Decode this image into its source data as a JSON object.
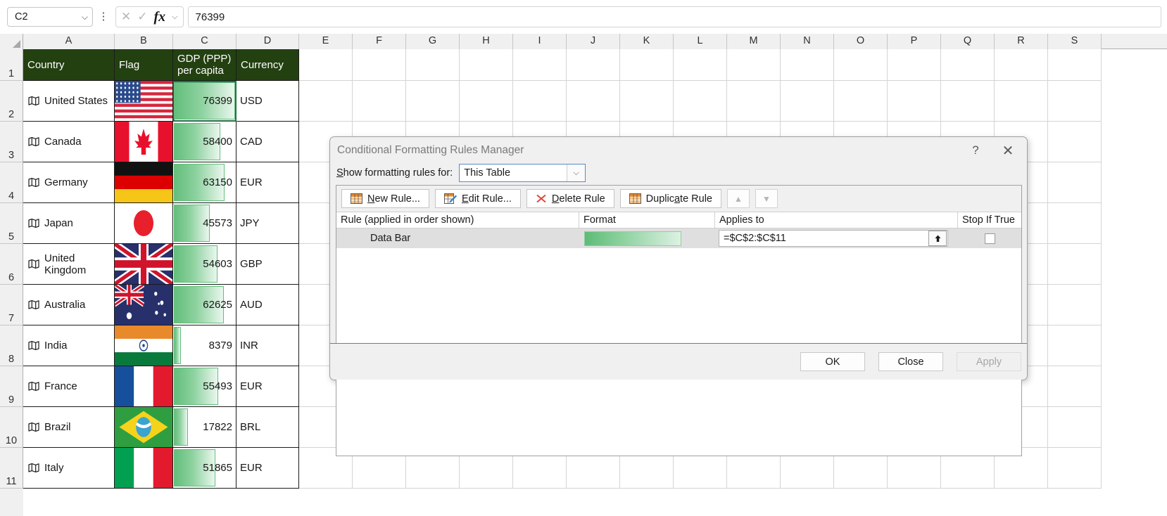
{
  "formula_bar": {
    "name_box": "C2",
    "name_box_chevron": "chevron-down-icon",
    "menu_icon": "⋮",
    "cancel_icon": "✕",
    "confirm_icon": "✓",
    "fx_icon": "fx",
    "fx_chevron": "chevron-down-icon",
    "formula_value": "76399"
  },
  "grid": {
    "columns": [
      "A",
      "B",
      "C",
      "D",
      "E",
      "F",
      "G",
      "H",
      "I",
      "J",
      "K",
      "L",
      "M",
      "N",
      "O",
      "P",
      "Q",
      "R",
      "S"
    ],
    "rows": [
      "1",
      "2",
      "3",
      "4",
      "5",
      "6",
      "7",
      "8",
      "9",
      "10",
      "11"
    ],
    "header_bg": "#234011",
    "headers": {
      "country": "Country",
      "flag": "Flag",
      "gdp_line1": "GDP (PPP)",
      "gdp_line2": "per capita",
      "currency": "Currency"
    },
    "data": [
      {
        "row": "2",
        "country": "United States",
        "flag": "us",
        "gdp": "76399",
        "currency": "USD",
        "bar_pct": 100
      },
      {
        "row": "3",
        "country": "Canada",
        "flag": "ca",
        "gdp": "58400",
        "currency": "CAD",
        "bar_pct": 76
      },
      {
        "row": "4",
        "country": "Germany",
        "flag": "de",
        "gdp": "63150",
        "currency": "EUR",
        "bar_pct": 83
      },
      {
        "row": "5",
        "country": "Japan",
        "flag": "jp",
        "gdp": "45573",
        "currency": "JPY",
        "bar_pct": 59
      },
      {
        "row": "6",
        "country": "United Kingdom",
        "flag": "gb",
        "gdp": "54603",
        "currency": "GBP",
        "bar_pct": 71
      },
      {
        "row": "7",
        "country": "Australia",
        "flag": "au",
        "gdp": "62625",
        "currency": "AUD",
        "bar_pct": 82
      },
      {
        "row": "8",
        "country": "India",
        "flag": "in",
        "gdp": "8379",
        "currency": "INR",
        "bar_pct": 11
      },
      {
        "row": "9",
        "country": "France",
        "flag": "fr",
        "gdp": "55493",
        "currency": "EUR",
        "bar_pct": 72
      },
      {
        "row": "10",
        "country": "Brazil",
        "flag": "br",
        "gdp": "17822",
        "currency": "BRL",
        "bar_pct": 23
      },
      {
        "row": "11",
        "country": "Italy",
        "flag": "it",
        "gdp": "51865",
        "currency": "EUR",
        "bar_pct": 68
      }
    ]
  },
  "dialog": {
    "title": "Conditional Formatting Rules Manager",
    "help_icon": "?",
    "close_icon": "✕",
    "show_label_pre": "S",
    "show_label_rest": "how formatting rules for:",
    "show_value": "This Table",
    "toolbar": {
      "new_rule_pre": "N",
      "new_rule_rest": "ew Rule...",
      "edit_rule_a": "Edit Rule...",
      "edit_rule_u": "E",
      "delete_rule_pre": "D",
      "delete_rule_rest": "elete Rule",
      "duplicate_pre": "Duplic",
      "duplicate_u": "a",
      "duplicate_rest": "te Rule",
      "move_up_icon": "chevron-up-icon",
      "move_down_icon": "chevron-down-icon"
    },
    "table_headers": {
      "rule": "Rule (applied in order shown)",
      "format": "Format",
      "applies_to": "Applies to",
      "stop_if_true": "Stop If True"
    },
    "rule_row": {
      "name": "Data Bar",
      "format_preview": "data-bar-gradient",
      "applies_to": "=$C$2:$C$11",
      "range_picker_icon": "range-selector-icon",
      "stop_if_true_checked": false
    },
    "footer": {
      "ok": "OK",
      "close": "Close",
      "apply": "Apply"
    }
  }
}
